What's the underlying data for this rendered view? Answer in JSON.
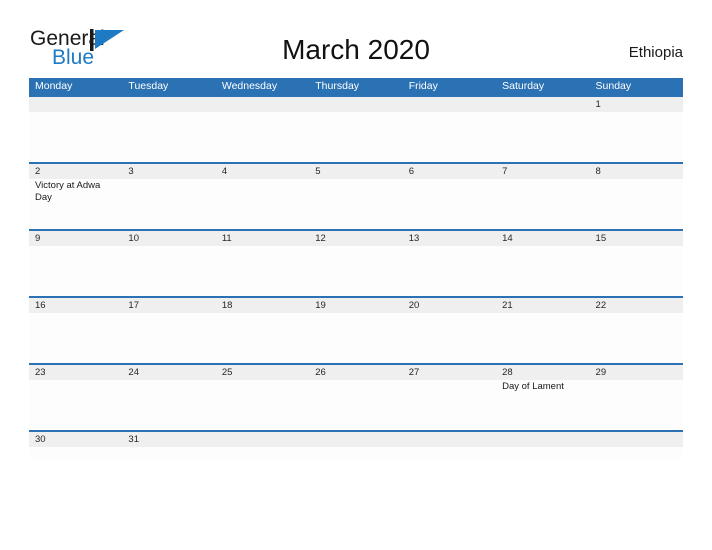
{
  "brand": {
    "word_general": "General",
    "word_blue": "Blue",
    "accent_color": "#1f7ac4"
  },
  "header": {
    "title": "March 2020",
    "country": "Ethiopia"
  },
  "calendar": {
    "header_color": "#2b72b4",
    "band_color": "#efefef",
    "weekdays": [
      "Monday",
      "Tuesday",
      "Wednesday",
      "Thursday",
      "Friday",
      "Saturday",
      "Sunday"
    ],
    "weeks": [
      {
        "short": false,
        "days": [
          {
            "num": "",
            "event": ""
          },
          {
            "num": "",
            "event": ""
          },
          {
            "num": "",
            "event": ""
          },
          {
            "num": "",
            "event": ""
          },
          {
            "num": "",
            "event": ""
          },
          {
            "num": "",
            "event": ""
          },
          {
            "num": "1",
            "event": ""
          }
        ]
      },
      {
        "short": false,
        "days": [
          {
            "num": "2",
            "event": "Victory at Adwa Day"
          },
          {
            "num": "3",
            "event": ""
          },
          {
            "num": "4",
            "event": ""
          },
          {
            "num": "5",
            "event": ""
          },
          {
            "num": "6",
            "event": ""
          },
          {
            "num": "7",
            "event": ""
          },
          {
            "num": "8",
            "event": ""
          }
        ]
      },
      {
        "short": false,
        "days": [
          {
            "num": "9",
            "event": ""
          },
          {
            "num": "10",
            "event": ""
          },
          {
            "num": "11",
            "event": ""
          },
          {
            "num": "12",
            "event": ""
          },
          {
            "num": "13",
            "event": ""
          },
          {
            "num": "14",
            "event": ""
          },
          {
            "num": "15",
            "event": ""
          }
        ]
      },
      {
        "short": false,
        "days": [
          {
            "num": "16",
            "event": ""
          },
          {
            "num": "17",
            "event": ""
          },
          {
            "num": "18",
            "event": ""
          },
          {
            "num": "19",
            "event": ""
          },
          {
            "num": "20",
            "event": ""
          },
          {
            "num": "21",
            "event": ""
          },
          {
            "num": "22",
            "event": ""
          }
        ]
      },
      {
        "short": false,
        "days": [
          {
            "num": "23",
            "event": ""
          },
          {
            "num": "24",
            "event": ""
          },
          {
            "num": "25",
            "event": ""
          },
          {
            "num": "26",
            "event": ""
          },
          {
            "num": "27",
            "event": ""
          },
          {
            "num": "28",
            "event": "Day of Lament"
          },
          {
            "num": "29",
            "event": ""
          }
        ]
      },
      {
        "short": true,
        "days": [
          {
            "num": "30",
            "event": ""
          },
          {
            "num": "31",
            "event": ""
          },
          {
            "num": "",
            "event": ""
          },
          {
            "num": "",
            "event": ""
          },
          {
            "num": "",
            "event": ""
          },
          {
            "num": "",
            "event": ""
          },
          {
            "num": "",
            "event": ""
          }
        ]
      }
    ]
  }
}
